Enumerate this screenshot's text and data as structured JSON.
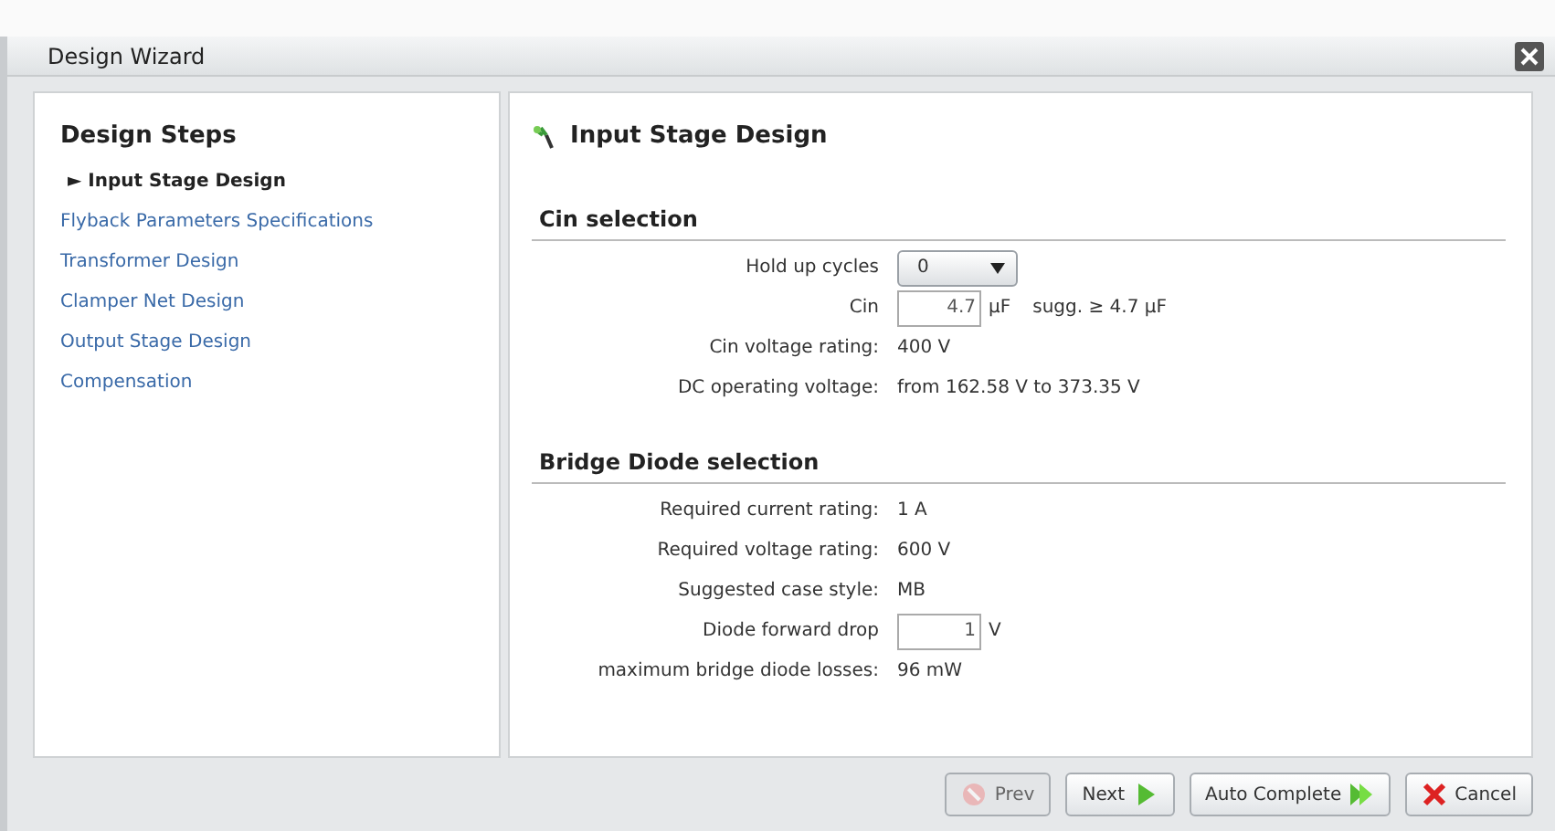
{
  "window": {
    "title": "Design Wizard"
  },
  "steps": {
    "heading": "Design Steps",
    "marker": "►",
    "items": [
      {
        "label": "Input Stage Design",
        "selected": true
      },
      {
        "label": "Flyback Parameters Specifications",
        "selected": false
      },
      {
        "label": "Transformer Design",
        "selected": false
      },
      {
        "label": "Clamper Net Design",
        "selected": false
      },
      {
        "label": "Output Stage Design",
        "selected": false
      },
      {
        "label": "Compensation",
        "selected": false
      }
    ]
  },
  "page": {
    "title": "Input Stage Design"
  },
  "sections": [
    {
      "heading": "Cin selection",
      "rows": [
        {
          "kind": "select",
          "label": "Hold up cycles",
          "value": "0"
        },
        {
          "kind": "input",
          "label": "Cin",
          "value": "4.7",
          "unit": "µF",
          "note": "sugg. ≥ 4.7 µF"
        },
        {
          "kind": "text",
          "label": "Cin voltage rating:",
          "value": "400 V"
        },
        {
          "kind": "text",
          "label": "DC operating voltage:",
          "value": "from 162.58 V to 373.35 V"
        }
      ]
    },
    {
      "heading": "Bridge Diode selection",
      "rows": [
        {
          "kind": "text",
          "label": "Required current rating:",
          "value": "1 A"
        },
        {
          "kind": "text",
          "label": "Required voltage rating:",
          "value": "600 V"
        },
        {
          "kind": "text",
          "label": "Suggested case style:",
          "value": "MB"
        },
        {
          "kind": "input",
          "label": "Diode forward drop",
          "value": "1",
          "unit": "V"
        },
        {
          "kind": "text",
          "label": "maximum bridge diode losses:",
          "value": "96 mW"
        }
      ]
    }
  ],
  "buttons": [
    {
      "kind": "prev",
      "label": "Prev",
      "disabled": true
    },
    {
      "kind": "next",
      "label": "Next",
      "disabled": false
    },
    {
      "kind": "auto",
      "label": "Auto Complete",
      "disabled": false
    },
    {
      "kind": "cancel",
      "label": "Cancel",
      "disabled": false
    }
  ]
}
